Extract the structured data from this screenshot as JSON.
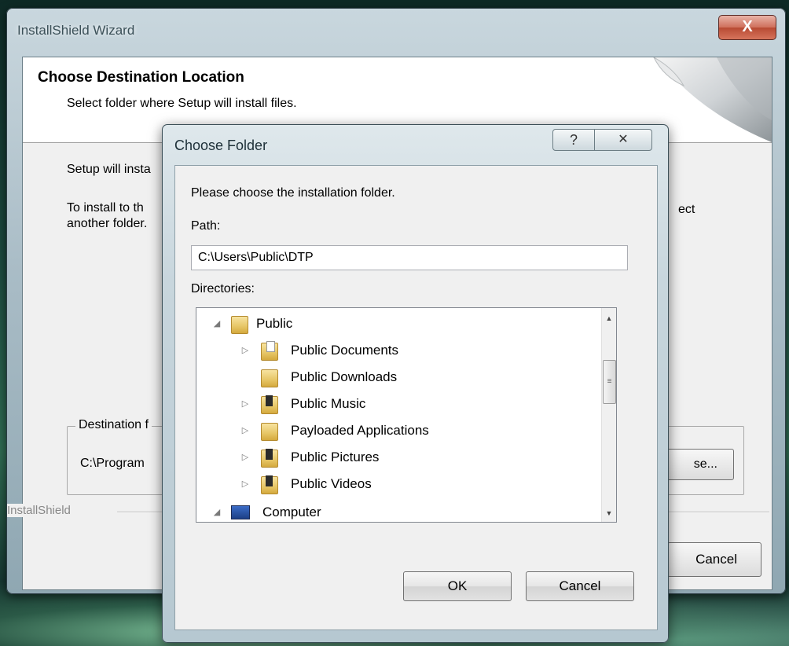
{
  "wizard": {
    "title": "InstallShield Wizard",
    "close_glyph": "X",
    "header_title": "Choose Destination Location",
    "header_subtitle": "Select folder where Setup will install files.",
    "body_line1": "Setup will insta",
    "body_line2a": "To install to th",
    "body_line2b": "another folder.",
    "body_line2c": "ect",
    "destination_legend": "Destination f",
    "destination_path": "C:\\Program",
    "browse_label": "se...",
    "brand_label": "InstallShield",
    "cancel_label": "Cancel"
  },
  "dialog": {
    "title": "Choose Folder",
    "help_glyph": "?",
    "close_glyph": "✕",
    "prompt": "Please choose the installation folder.",
    "path_label": "Path:",
    "path_value": "C:\\Users\\Public\\DTP",
    "directories_label": "Directories:",
    "tree": [
      {
        "label": "Public",
        "arrow": "◢",
        "level": 0,
        "icon": "folder-icon"
      },
      {
        "label": "Public Documents",
        "arrow": "▷",
        "level": 1,
        "icon": "documents-folder-icon"
      },
      {
        "label": "Public Downloads",
        "arrow": "",
        "level": 1,
        "icon": "folder-icon"
      },
      {
        "label": "Public Music",
        "arrow": "▷",
        "level": 1,
        "icon": "music-folder-icon"
      },
      {
        "label": "Payloaded Applications",
        "arrow": "▷",
        "level": 1,
        "icon": "folder-icon"
      },
      {
        "label": "Public Pictures",
        "arrow": "▷",
        "level": 1,
        "icon": "pictures-folder-icon"
      },
      {
        "label": "Public Videos",
        "arrow": "▷",
        "level": 1,
        "icon": "videos-folder-icon"
      },
      {
        "label": "Computer",
        "arrow": "◢",
        "level": 0,
        "icon": "computer-icon"
      }
    ],
    "ok_label": "OK",
    "cancel_label": "Cancel"
  }
}
